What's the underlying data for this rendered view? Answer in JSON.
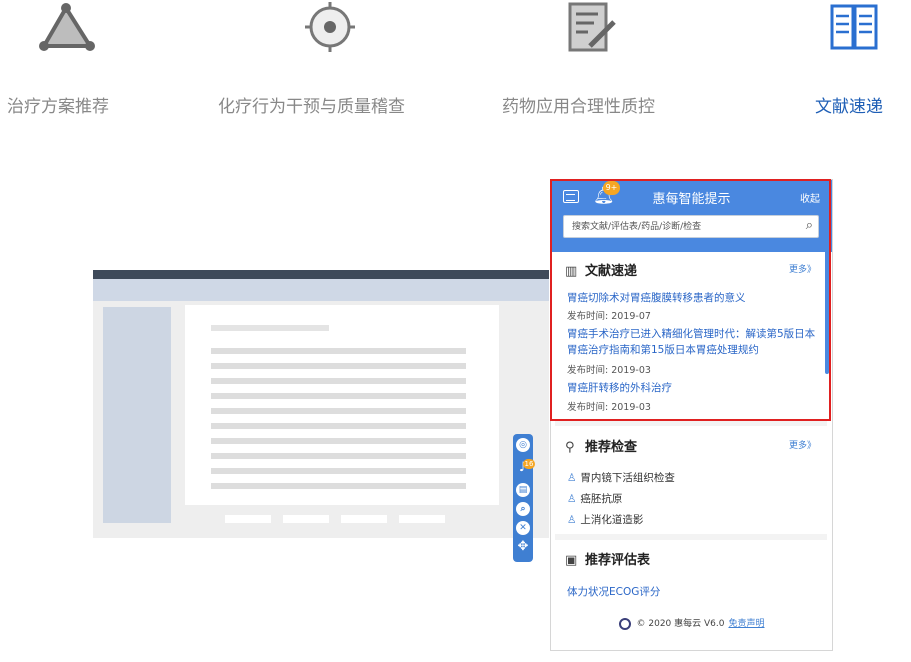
{
  "features": [
    {
      "label": "治疗方案推荐",
      "icon": "triangle-network-icon"
    },
    {
      "label": "化疗行为干预与质量稽查",
      "icon": "target-icon"
    },
    {
      "label": "药物应用合理性质控",
      "icon": "edit-document-icon"
    },
    {
      "label": "文献速递",
      "icon": "open-book-icon",
      "active": true
    }
  ],
  "toolbar": {
    "badge": "16"
  },
  "panel": {
    "title": "惠每智能提示",
    "badge": "9+",
    "collapse": "收起",
    "search_placeholder": "搜索文献/评估表/药品/诊断/检查",
    "literature": {
      "heading": "文献速递",
      "more": "更多》",
      "articles": [
        {
          "title": "胃癌切除术对胃癌腹膜转移患者的意义",
          "date": "发布时间: 2019-07"
        },
        {
          "title": "胃癌手术治疗已进入精细化管理时代：解读第5版日本胃癌治疗指南和第15版日本胃癌处理规约",
          "date": "发布时间: 2019-03"
        },
        {
          "title": "胃癌肝转移的外科治疗",
          "date": "发布时间: 2019-03"
        }
      ]
    },
    "exams": {
      "heading": "推荐检查",
      "more": "更多》",
      "items": [
        "胃内镜下活组织检查",
        "癌胚抗原",
        "上消化道造影"
      ]
    },
    "assessment": {
      "heading": "推荐评估表",
      "items": [
        "体力状况ECOG评分"
      ]
    },
    "footer": {
      "copyright": "© 2020 惠每云 V6.0",
      "disclaimer": "免责声明"
    }
  },
  "colors": {
    "accent": "#4a88e0",
    "link": "#2a66c7",
    "highlight": "#e02020",
    "badge": "#f5a623"
  }
}
